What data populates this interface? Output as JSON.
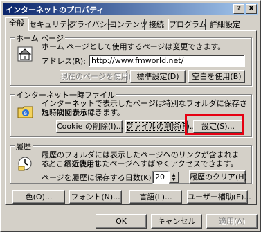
{
  "window": {
    "title": "インターネットのプロパティ",
    "help_glyph": "?",
    "close_glyph": "X"
  },
  "tabs": [
    "全般",
    "セキュリティ",
    "プライバシー",
    "コンテンツ",
    "接続",
    "プログラム",
    "詳細設定"
  ],
  "home": {
    "label": "ホーム ページ",
    "description": "ホーム ページとして使用するページは変更できます。",
    "address_label": "アドレス(R):",
    "address_value": "http://www.fmworld.net/",
    "btn_current": "現在のページを使用(C)",
    "btn_default": "標準設定(D)",
    "btn_blank": "空白を使用(B)"
  },
  "temp": {
    "label": "インターネット一時ファイル",
    "description_1": "インターネットで表示したページは特別なフォルダに保存され、次回からは",
    "description_2": "短時間で表示できます。",
    "btn_cookie": "Cookie の削除(I)...",
    "btn_files": "ファイルの削除(F)...",
    "btn_settings": "設定(S)..."
  },
  "history": {
    "label": "履歴",
    "description_1": "履歴のフォルダには表示したページへのリンクが含まれます。これを使用す",
    "description_2": "ると、最近表示したページへすばやくアクセスできます。",
    "days_label": "ページを履歴に保存する日数(K):",
    "days_value": "20",
    "btn_clear": "履歴のクリア(H)"
  },
  "bottom_buttons": {
    "colors": "色(O)...",
    "fonts": "フォント(N)...",
    "languages": "言語(L)...",
    "accessibility": "ユーザー補助(E)..."
  },
  "dialog_buttons": {
    "ok": "OK",
    "cancel": "キャンセル",
    "apply": "適用(A)"
  },
  "colors": {
    "highlight": "#e60012",
    "titlebar": "#0a246a"
  }
}
